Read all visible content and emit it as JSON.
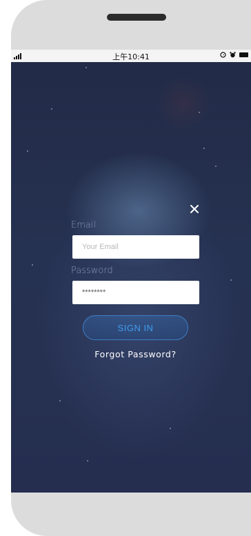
{
  "status_bar": {
    "time": "上午10:41",
    "icons": [
      "signal-icon",
      "alarm-icon",
      "battery-icon"
    ]
  },
  "login": {
    "email_label": "Email",
    "email_placeholder": "Your Email",
    "email_value": "",
    "password_label": "Password",
    "password_value": "********",
    "signin_label": "SIGN IN",
    "forgot_label": "Forgot Password?"
  },
  "colors": {
    "background": "#252e4f",
    "button_border": "#3d7fc4",
    "button_text": "#3f9df0",
    "label_text": "#8c98b5",
    "device_frame": "#dcdcdc"
  }
}
